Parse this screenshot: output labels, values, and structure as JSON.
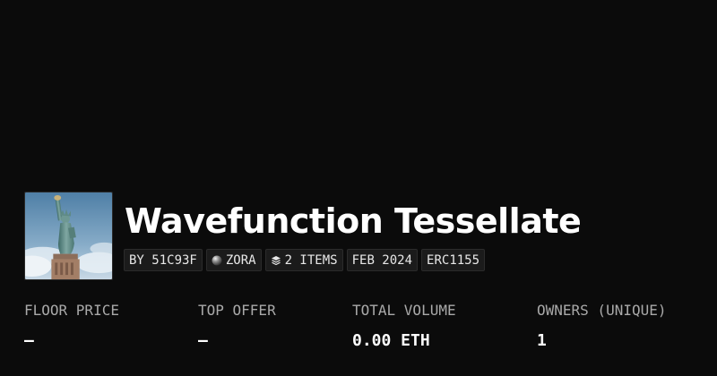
{
  "collection": {
    "title": "Wavefunction Tessellate",
    "thumbnail_icon": "statue-of-liberty-image",
    "tags": [
      {
        "label": "BY 51C93F"
      },
      {
        "label": "ZORA",
        "icon": "zora-orb-icon"
      },
      {
        "label": "2 ITEMS",
        "icon": "layers-icon"
      },
      {
        "label": "FEB 2024"
      },
      {
        "label": "ERC1155"
      }
    ]
  },
  "stats": [
    {
      "label": "FLOOR PRICE",
      "value": "—"
    },
    {
      "label": "TOP OFFER",
      "value": "—"
    },
    {
      "label": "TOTAL VOLUME",
      "value": "0.00 ETH"
    },
    {
      "label": "OWNERS (UNIQUE)",
      "value": "1"
    }
  ],
  "colors": {
    "background": "#0b0b0b",
    "tag_background": "#1b1b1b",
    "label_text": "#a9a9a9",
    "value_text": "#ffffff"
  }
}
